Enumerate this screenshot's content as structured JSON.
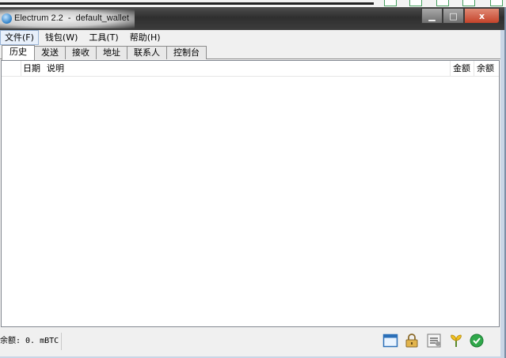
{
  "window": {
    "title": "Electrum 2.2  -  default_wallet",
    "buttons": {
      "minimize": "▁",
      "maximize": "□",
      "close": "x"
    }
  },
  "menu": [
    "文件(F)",
    "钱包(W)",
    "工具(T)",
    "帮助(H)"
  ],
  "tabs": [
    "历史",
    "发送",
    "接收",
    "地址",
    "联系人",
    "控制台"
  ],
  "active_tab": "历史",
  "history": {
    "columns": {
      "date": "日期",
      "description": "说明",
      "amount": "金额",
      "balance": "余额"
    },
    "rows": []
  },
  "status": {
    "balance": "余额: 0. mBTC",
    "icons": [
      "wallet-icon",
      "lock-icon",
      "preferences-icon",
      "seed-icon",
      "network-status-icon"
    ]
  },
  "colors": {
    "titlebar": "#3a3a3a",
    "window_frame": "#c9d6e6",
    "close_button": "#c5432a",
    "network_ok": "#2fa84a"
  }
}
